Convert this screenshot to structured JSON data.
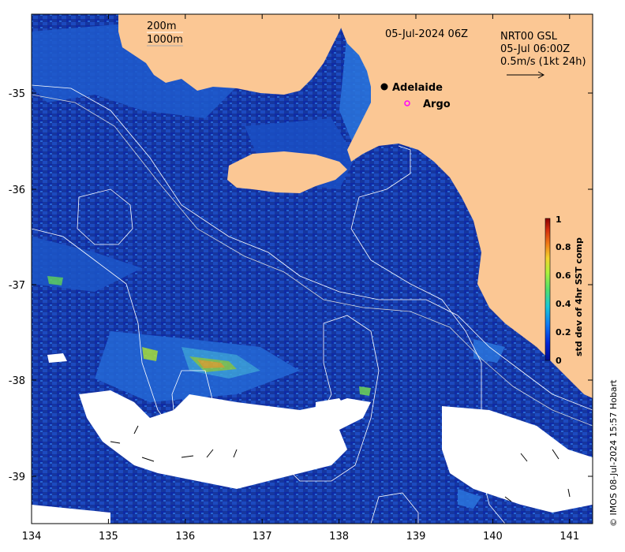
{
  "map": {
    "x_ticks": [
      "134",
      "135",
      "136",
      "137",
      "138",
      "139",
      "140",
      "141"
    ],
    "y_ticks": [
      "-35",
      "-36",
      "-37",
      "-38",
      "-39"
    ],
    "lon_range": [
      134,
      141.3
    ],
    "lat_range": [
      -39.5,
      -34.2
    ]
  },
  "legend": {
    "isobath_shallow": "200m",
    "isobath_deep": "1000m"
  },
  "timestamp": "05-Jul-2024 06Z",
  "current_info": {
    "line1": "NRT00 GSL",
    "line2": "05-Jul 06:00Z",
    "line3": "0.5m/s (1kt 24h)"
  },
  "places": [
    {
      "name": "Adelaide",
      "marker": "filled-dot",
      "lon": 138.6,
      "lat": -34.93
    },
    {
      "name": "Argo",
      "marker": "magenta-ring",
      "lon": 138.8,
      "lat": -35.11
    }
  ],
  "colorbar": {
    "label": "std dev of 4hr SST comp",
    "ticks": [
      "0",
      "0.2",
      "0.4",
      "0.6",
      "0.8",
      "1"
    ],
    "range": [
      0,
      1
    ],
    "colors": [
      "#000c8f",
      "#0025d8",
      "#0f79f5",
      "#19c8d6",
      "#52e06b",
      "#aef23c",
      "#f4d32d",
      "#f27c17",
      "#d42d0c",
      "#8b0000"
    ]
  },
  "credit": "© IMOS 08-Jul-2024 15:57 Hobart",
  "colors": {
    "land": "#fbc794",
    "ocean_base": "#1434b4",
    "no_data": "#ffffff"
  }
}
